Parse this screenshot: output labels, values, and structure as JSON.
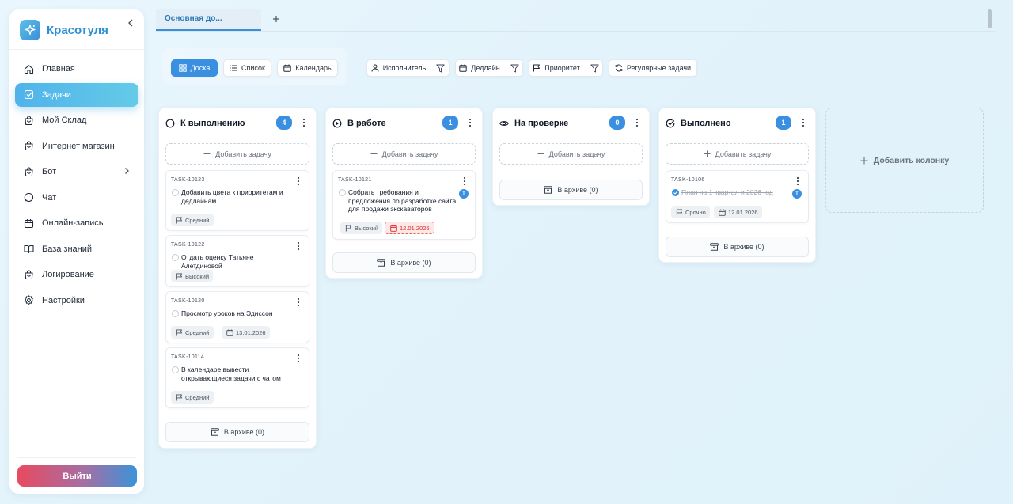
{
  "brand": {
    "name": "Красотуля",
    "accent": "#2b8fd3"
  },
  "sidebar": {
    "items": [
      {
        "label": "Главная",
        "icon": "home-icon",
        "active": false
      },
      {
        "label": "Задачи",
        "icon": "tasks-icon",
        "active": true
      },
      {
        "label": "Мой Склад",
        "icon": "warehouse-icon",
        "active": false
      },
      {
        "label": "Интернет магазин",
        "icon": "shop-icon",
        "active": false
      },
      {
        "label": "Бот",
        "icon": "bot-icon",
        "active": false,
        "has_submenu": true
      },
      {
        "label": "Чат",
        "icon": "chat-icon",
        "active": false
      },
      {
        "label": "Онлайн-запись",
        "icon": "calendar-icon",
        "active": false
      },
      {
        "label": "База знаний",
        "icon": "book-icon",
        "active": false
      },
      {
        "label": "Логирование",
        "icon": "log-icon",
        "active": false
      },
      {
        "label": "Настройки",
        "icon": "gear-icon",
        "active": false
      }
    ],
    "logout_label": "Выйти"
  },
  "tabs": [
    {
      "label": "Основная до...",
      "active": true
    }
  ],
  "toolbar": {
    "views": [
      {
        "label": "Доска",
        "icon": "grid-icon",
        "active": true
      },
      {
        "label": "Список",
        "icon": "list-icon",
        "active": false
      },
      {
        "label": "Календарь",
        "icon": "calendar-icon",
        "active": false
      }
    ],
    "filters": [
      {
        "label": "Исполнитель",
        "icon": "user-icon"
      },
      {
        "label": "Дедлайн",
        "icon": "calendar-icon"
      },
      {
        "label": "Приоритет",
        "icon": "flag-icon"
      }
    ],
    "recurring_label": "Регулярные задачи"
  },
  "board": {
    "add_task_label": "Добавить задачу",
    "add_column_label": "Добавить колонку",
    "columns": [
      {
        "title": "К выполнению",
        "icon": "circle-icon",
        "count": "4",
        "archive_label": "В архиве (0)",
        "cards": [
          {
            "id": "TASK-10123",
            "title": "Добавить цвета к приоритетам и дедлайнам",
            "priority": "Средний"
          },
          {
            "id": "TASK-10122",
            "title": "Отдать оценку Татьяне Алетдиновой",
            "priority": "Высокий"
          },
          {
            "id": "TASK-10120",
            "title": "Просмотр уроков на Эдиссон",
            "priority": "Средний",
            "deadline": "13.01.2026"
          },
          {
            "id": "TASK-10114",
            "title": "В календаре вывести открывающиеся задачи с чатом",
            "priority": "Средний"
          }
        ]
      },
      {
        "title": "В работе",
        "icon": "play-icon",
        "count": "1",
        "archive_label": "В архиве (0)",
        "cards": [
          {
            "id": "TASK-10121",
            "title": "Собрать требования и предложения по разработке сайта для продажи экскаваторов",
            "priority": "Высокий",
            "deadline": "12.01.2026",
            "overdue": true,
            "assignee": "Т"
          }
        ]
      },
      {
        "title": "На проверке",
        "icon": "eye-icon",
        "count": "0",
        "archive_label": "В архиве (0)",
        "cards": []
      },
      {
        "title": "Выполнено",
        "icon": "check-circle-icon",
        "count": "1",
        "archive_label": "В архиве (0)",
        "cards": [
          {
            "id": "TASK-10106",
            "title": "План на 1 квартал и 2026 год",
            "priority": "Срочно",
            "deadline": "12.01.2026",
            "done": true,
            "assignee": "Т"
          }
        ]
      }
    ]
  }
}
